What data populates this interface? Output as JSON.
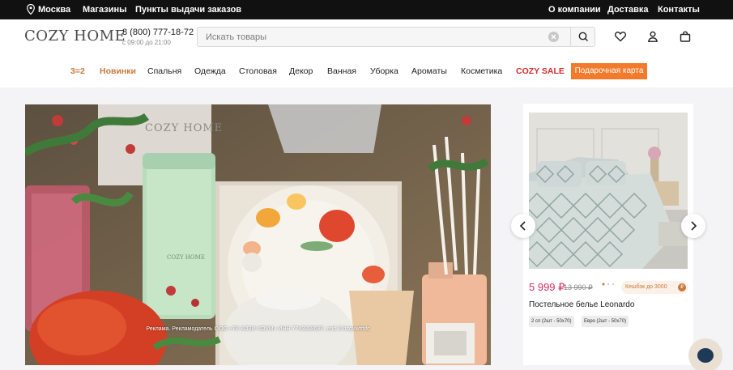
{
  "topbar": {
    "city": "Москва",
    "stores": "Магазины",
    "pickup": "Пункты выдачи заказов",
    "about": "О компании",
    "delivery": "Доставка",
    "contacts": "Контакты"
  },
  "header": {
    "logo": "COZY HOME",
    "phone": "8 (800) 777-18-72",
    "hours": "с 09:00 до 21:00",
    "icons": [
      "search-icon",
      "heart-icon",
      "user-icon",
      "bag-icon",
      "clear-icon"
    ]
  },
  "search": {
    "placeholder": "Искать товары",
    "value": ""
  },
  "nav": {
    "promo": "3=2",
    "new": "Новинки",
    "bedroom": "Спальня",
    "clothes": "Одежда",
    "dining": "Столовая",
    "decor": "Декор",
    "bathroom": "Ванная",
    "cleaning": "Уборка",
    "aromas": "Ароматы",
    "cosmetics": "Косметика",
    "sale": "COZY SALE",
    "giftcard": "Подарочная карта"
  },
  "banner": {
    "box_label": "COZY HOME",
    "can_label": "COZY HOME",
    "legal": "Реклама. Рекламодатель ООО «ТК КОЗИ ХОУМ» ИНН 7743238687, erid 2Vtzqvwfmfc"
  },
  "product": {
    "price": "5 999 ₽",
    "old_price": "13 990 ₽",
    "cashback": "Кешбэк до 3000",
    "cashback_badge": "₽",
    "name": "Постельное белье Leonardo",
    "sizes": [
      "2 сп (2шт - 50х70)",
      "Евро (2шт - 50х70)"
    ]
  },
  "colors": {
    "accent": "#c77a3d",
    "sale": "#d62b2b",
    "price": "#d62b5d",
    "gift_button": "#f27a2a",
    "topbar": "#111111",
    "chat": "#1f3a57"
  }
}
